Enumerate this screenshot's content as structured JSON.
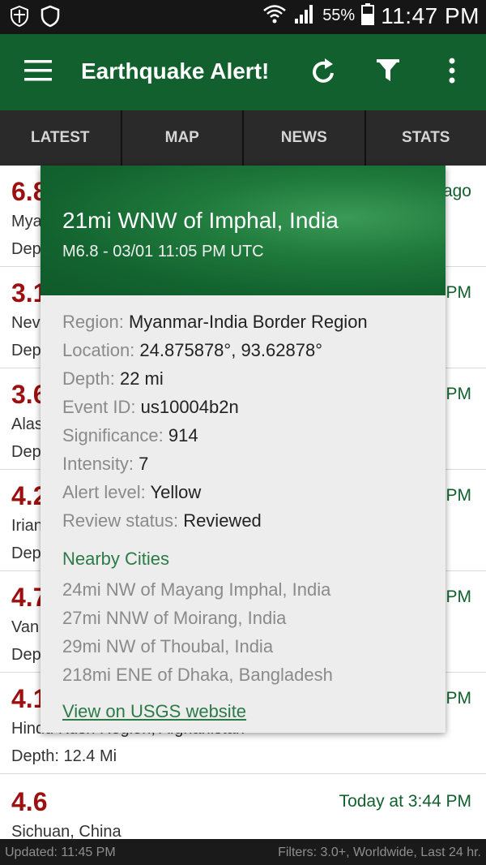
{
  "status_bar": {
    "battery_pct": "55%",
    "clock": "11:47 PM",
    "icons": [
      "shield-check-icon",
      "shield-icon",
      "wifi-icon",
      "signal-icon",
      "battery-icon"
    ]
  },
  "app_bar": {
    "title": "Earthquake Alert!",
    "icons": [
      "menu-icon",
      "refresh-icon",
      "filter-icon",
      "more-vert-icon"
    ],
    "color": "#11602e"
  },
  "tabs": [
    {
      "label": "LATEST"
    },
    {
      "label": "MAP"
    },
    {
      "label": "NEWS"
    },
    {
      "label": "STATS"
    }
  ],
  "quakes": [
    {
      "mag": "6.8",
      "place": "Mya",
      "depth": "Dep",
      "time": "ago"
    },
    {
      "mag": "3.1",
      "place": "Nev",
      "depth": "Dep",
      "time": "PM"
    },
    {
      "mag": "3.6",
      "place": "Alas",
      "depth": "Dep",
      "time": "PM"
    },
    {
      "mag": "4.2",
      "place": "Irian",
      "depth": "Dep",
      "time": "PM"
    },
    {
      "mag": "4.7",
      "place": "Van",
      "depth": "Dep",
      "time": "PM"
    },
    {
      "mag": "4.1",
      "place": "Hindu Kush Region, Afghanistan",
      "depth": "Depth: 12.4 Mi",
      "time": "PM"
    },
    {
      "mag": "4.6",
      "place": "Sichuan, China",
      "depth": "",
      "time": "Today at 3:44 PM"
    }
  ],
  "dialog": {
    "title": "21mi WNW of Imphal, India",
    "subtitle": "M6.8 - 03/01 11:05 PM UTC",
    "details": [
      {
        "label": "Region:",
        "value": "Myanmar-India Border Region"
      },
      {
        "label": "Location:",
        "value": "24.875878°, 93.62878°"
      },
      {
        "label": "Depth:",
        "value": "22 mi"
      },
      {
        "label": "Event ID:",
        "value": "us10004b2n"
      },
      {
        "label": "Significance:",
        "value": "914"
      },
      {
        "label": "Intensity:",
        "value": "7"
      },
      {
        "label": "Alert level:",
        "value": "Yellow"
      },
      {
        "label": "Review status:",
        "value": "Reviewed"
      }
    ],
    "nearby_heading": "Nearby Cities",
    "nearby_cities": [
      "24mi NW of Mayang Imphal, India",
      "27mi NNW of Moirang, India",
      "29mi NW of Thoubal, India",
      "218mi ENE of Dhaka, Bangladesh"
    ],
    "link_text": "View on USGS website"
  },
  "footer": {
    "updated": "Updated: 11:45 PM",
    "filters": "Filters: 3.0+, Worldwide, Last 24 hr."
  },
  "colors": {
    "brand_green": "#11602e",
    "magnitude_red": "#9c1010",
    "link_green": "#2b7a47"
  }
}
